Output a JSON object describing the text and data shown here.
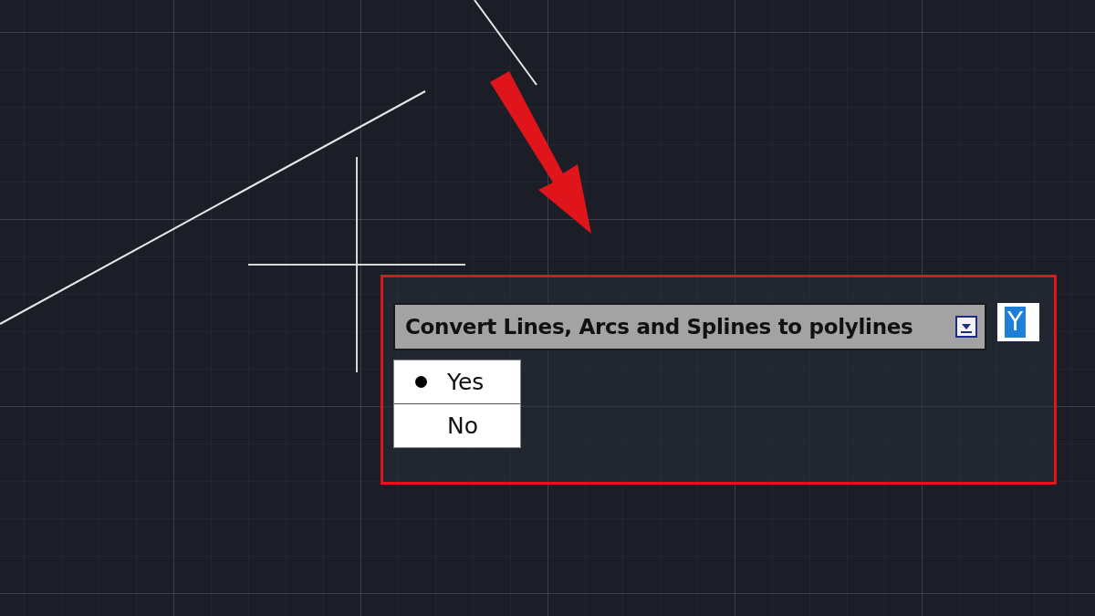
{
  "prompt": {
    "text": "Convert Lines, Arcs and Splines to polylines"
  },
  "input": {
    "value": "Y",
    "selected": true
  },
  "options": [
    {
      "label": "Yes",
      "selected": true
    },
    {
      "label": "No",
      "selected": false
    }
  ]
}
